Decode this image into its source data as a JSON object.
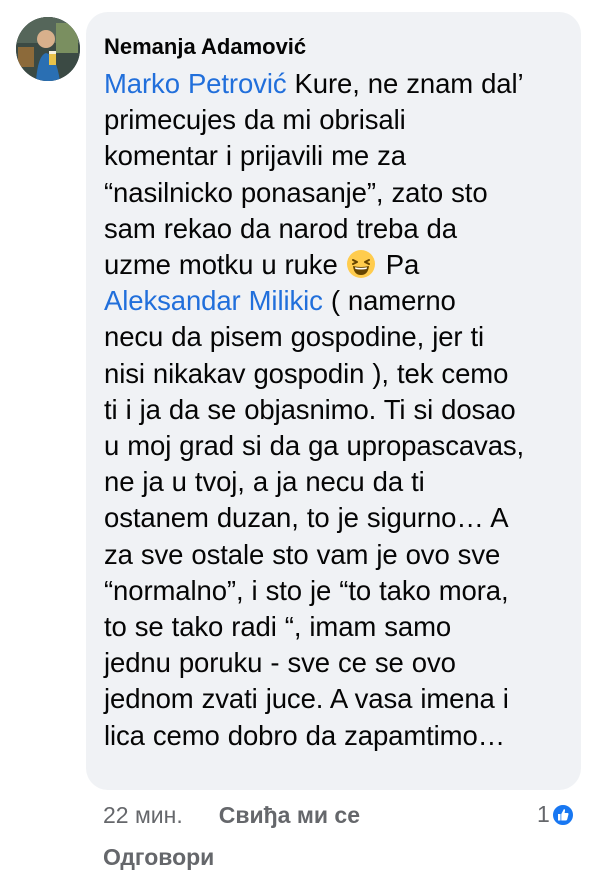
{
  "comment": {
    "author": "Nemanja Adamović",
    "lines": [
      [
        {
          "t": "mention",
          "v": "Marko Petrović"
        },
        {
          "t": "text",
          "v": " Kure, ne znam dal’"
        }
      ],
      [
        {
          "t": "text",
          "v": "primecujes da mi obrisali"
        }
      ],
      [
        {
          "t": "text",
          "v": "komentar i prijavili me za"
        }
      ],
      [
        {
          "t": "text",
          "v": "“nasilnicko ponasanje”, zato sto"
        }
      ],
      [
        {
          "t": "text",
          "v": "sam rekao da narod treba da"
        }
      ],
      [
        {
          "t": "text",
          "v": "uzme motku u ruke "
        },
        {
          "t": "emoji",
          "v": "grinning-squinting-face"
        },
        {
          "t": "text",
          "v": " Pa"
        }
      ],
      [
        {
          "t": "mention",
          "v": "Aleksandar Milikic"
        },
        {
          "t": "text",
          "v": " ( namerno"
        }
      ],
      [
        {
          "t": "text",
          "v": "necu da pisem gospodine, jer ti"
        }
      ],
      [
        {
          "t": "text",
          "v": "nisi nikakav gospodin ), tek cemo"
        }
      ],
      [
        {
          "t": "text",
          "v": "ti i ja da se objasnimo. Ti si dosao"
        }
      ],
      [
        {
          "t": "text",
          "v": "u moj grad si da ga upropascavas,"
        }
      ],
      [
        {
          "t": "text",
          "v": "ne ja u tvoj, a ja necu da ti"
        }
      ],
      [
        {
          "t": "text",
          "v": "ostanem duzan, to je sigurno… A"
        }
      ],
      [
        {
          "t": "text",
          "v": "za sve ostale sto vam je ovo sve"
        }
      ],
      [
        {
          "t": "text",
          "v": "“normalno”, i sto je “to tako mora,"
        }
      ],
      [
        {
          "t": "text",
          "v": "to se tako radi “, imam samo"
        }
      ],
      [
        {
          "t": "text",
          "v": "jednu poruku - sve ce se ovo"
        }
      ],
      [
        {
          "t": "text",
          "v": "jednom zvati juce. A vasa imena i"
        }
      ],
      [
        {
          "t": "text",
          "v": "lica cemo dobro da zapamtimo…"
        }
      ]
    ]
  },
  "meta": {
    "time": "22 мин.",
    "like_label": "Свиђа ми се",
    "reply_label": "Одговори",
    "reaction_count": "1",
    "reaction_icon": "like-icon"
  },
  "colors": {
    "bubble": "#f0f2f5",
    "mention": "#216fdb",
    "meta_text": "#65676b",
    "like_blue": "#1877f2"
  }
}
